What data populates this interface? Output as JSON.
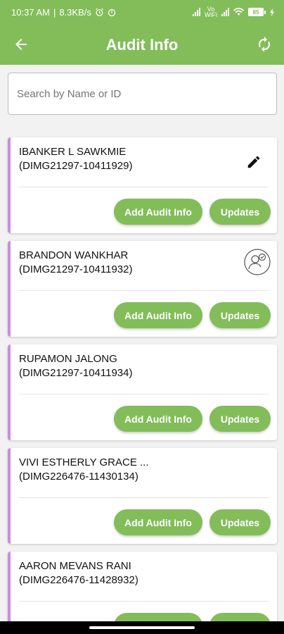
{
  "status_bar": {
    "time": "10:37 AM",
    "speed": "8.3KB/s",
    "network": "Vo WiFi",
    "battery": "85"
  },
  "app_bar": {
    "title": "Audit Info"
  },
  "search": {
    "placeholder": "Search by Name or ID"
  },
  "labels": {
    "add_audit_info": "Add Audit Info",
    "updates": "Updates"
  },
  "records": [
    {
      "name": "IBANKER L SAWKMIE",
      "id": "(DIMG21297-10411929)",
      "icon": "edit-icon"
    },
    {
      "name": "BRANDON WANKHAR",
      "id": "(DIMG21297-10411932)",
      "icon": "person-check-icon"
    },
    {
      "name": "RUPAMON JALONG",
      "id": "(DIMG21297-10411934)",
      "icon": ""
    },
    {
      "name": "VIVI ESTHERLY GRACE ...",
      "id": "(DIMG226476-11430134)",
      "icon": ""
    },
    {
      "name": "AARON MEVANS RANI",
      "id": "(DIMG226476-11428932)",
      "icon": ""
    }
  ],
  "colors": {
    "primary": "#82bd5a",
    "card_accent": "#c98de0"
  }
}
